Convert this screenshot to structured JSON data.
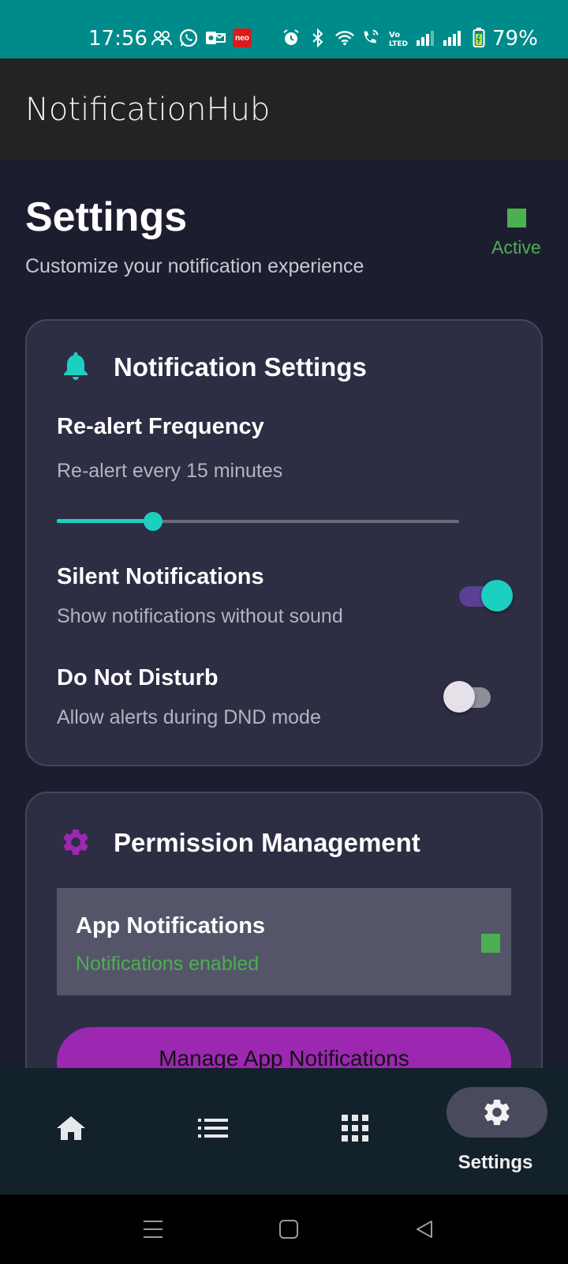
{
  "status_bar": {
    "time": "17:56",
    "battery_pct": "79%",
    "neo_badge": "neo",
    "icons_left": [
      "group-icon",
      "whatsapp-icon",
      "outlook-icon",
      "neo-app-icon"
    ],
    "icons_right": [
      "alarm-icon",
      "bluetooth-icon",
      "wifi-icon",
      "wifi-calling-icon",
      "volte-icon",
      "signal-1-icon",
      "signal-2-icon",
      "battery-icon"
    ],
    "background": "#008b8b"
  },
  "app_bar": {
    "title": "NotificationHub"
  },
  "header": {
    "title": "Settings",
    "subtitle": "Customize your notification experience",
    "status_label": "Active",
    "status_color": "#4caf50"
  },
  "notification_settings": {
    "title": "Notification Settings",
    "icon": "bell-icon",
    "realert": {
      "label": "Re-alert Frequency",
      "value_text": "Re-alert every 15 minutes",
      "slider_fraction": 0.24
    },
    "silent": {
      "label": "Silent Notifications",
      "description": "Show notifications without sound",
      "enabled": true
    },
    "dnd": {
      "label": "Do Not Disturb",
      "description": "Allow alerts during DND mode",
      "enabled": false
    }
  },
  "permission_management": {
    "title": "Permission Management",
    "icon": "gear-icon",
    "app_notifications": {
      "title": "App Notifications",
      "status": "Notifications enabled"
    },
    "button_label": "Manage App Notifications"
  },
  "bottom_nav": {
    "items": [
      {
        "icon": "home-icon",
        "label": ""
      },
      {
        "icon": "list-icon",
        "label": ""
      },
      {
        "icon": "grid-icon",
        "label": ""
      },
      {
        "icon": "gear-icon",
        "label": "Settings",
        "selected": true
      }
    ]
  },
  "colors": {
    "accent": "#1cd0c0",
    "primary_button": "#9c27b0",
    "card": "#2d2d44",
    "background": "#1d1d30"
  }
}
